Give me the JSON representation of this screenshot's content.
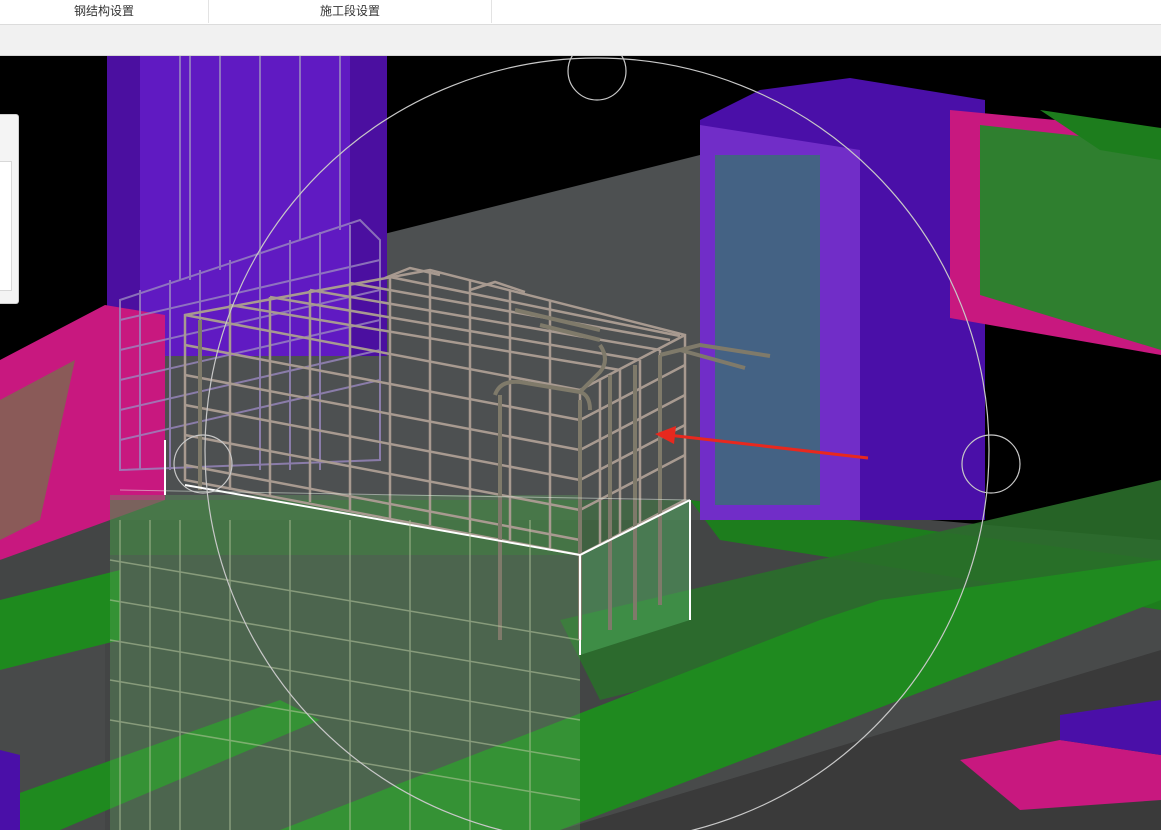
{
  "ribbon": {
    "groups": [
      {
        "label": "钢结构设置"
      },
      {
        "label": "施工段设置"
      }
    ]
  },
  "viewport": {
    "colors": {
      "background": "#000000",
      "column": "#5a10c8",
      "slab": "#1e8c1e",
      "beam_magenta": "#c8187f",
      "glass": "#9ab0b8",
      "rebar": "#a89a90",
      "selection_edge": "#ffffff",
      "arrow": "#e8281e",
      "orbit_ring": "#c8c8c8"
    },
    "icons": [
      "orbit-ring",
      "rebar-cage",
      "red-pointer-arrow"
    ]
  }
}
